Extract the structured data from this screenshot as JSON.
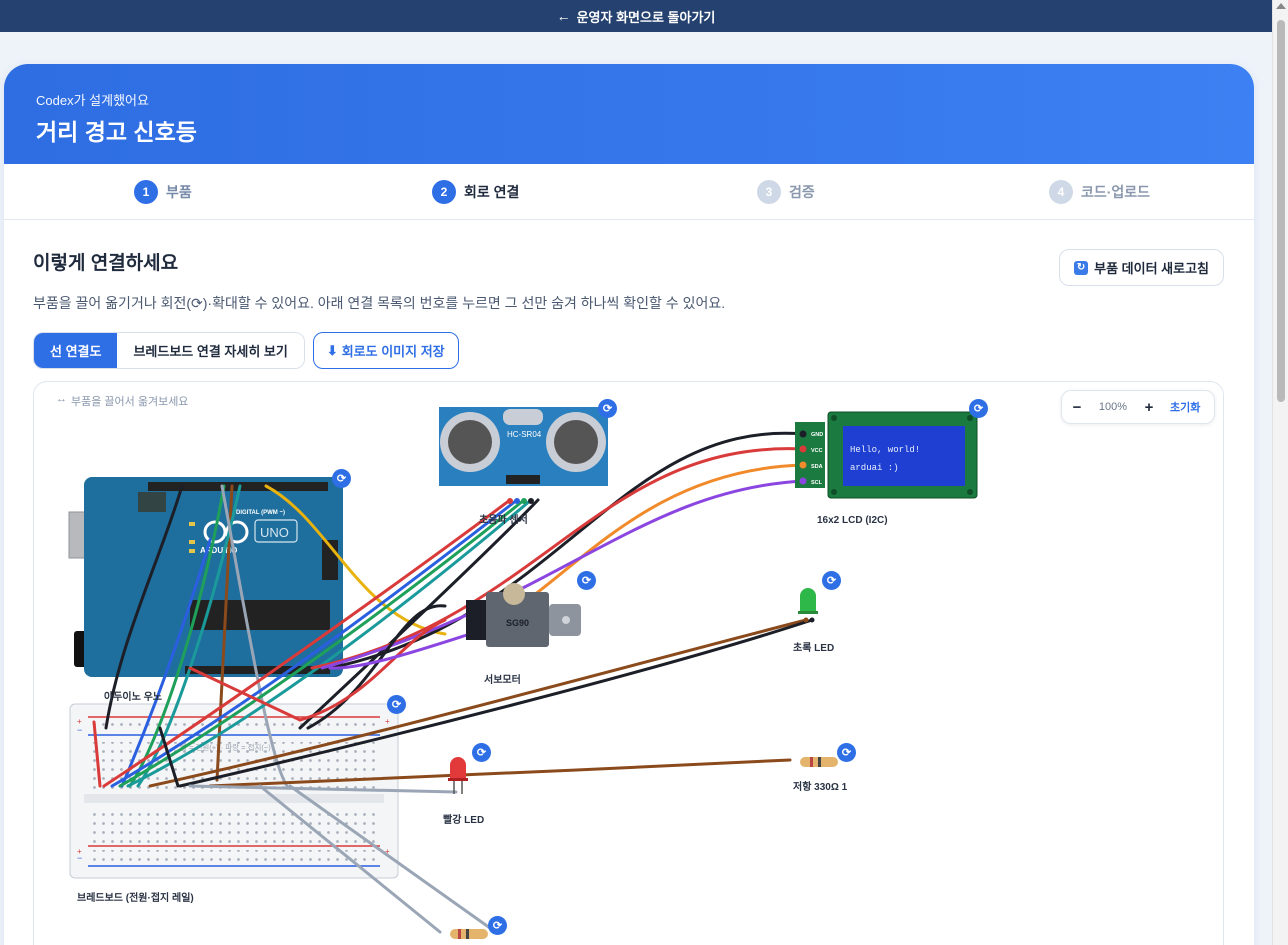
{
  "topbar": {
    "back_label": "운영자 화면으로 돌아가기"
  },
  "hero": {
    "subtitle": "Codex가 설계했어요",
    "title": "거리 경고 신호등"
  },
  "steps": [
    {
      "num": "1",
      "label": "부품"
    },
    {
      "num": "2",
      "label": "회로 연결"
    },
    {
      "num": "3",
      "label": "검증"
    },
    {
      "num": "4",
      "label": "코드·업로드"
    }
  ],
  "main": {
    "heading": "이렇게 연결하세요",
    "refresh_label": "부품 데이터 새로고침",
    "description": "부품을 끌어 옮기거나 회전(⟳)·확대할 수 있어요. 아래 연결 목록의 번호를 누르면 그 선만 숨겨 하나씩 확인할 수 있어요.",
    "tab_wire": "선 연결도",
    "tab_breadboard": "브레드보드 연결 자세히 보기",
    "save_image": "회로도 이미지 저장"
  },
  "canvas": {
    "hint": "부품을 끌어서 옮겨보세요",
    "zoom": {
      "minus": "−",
      "value": "100%",
      "plus": "+",
      "reset": "초기화"
    },
    "components": {
      "arduino": "아두이노 우노",
      "ultrasonic": "초음파 센서",
      "ultrasonic_chip": "HC-SR04",
      "lcd": "16x2 LCD (I2C)",
      "lcd_line1": "Hello, world!",
      "lcd_line2": "arduai :)",
      "lcd_pins": [
        "GND",
        "VCC",
        "SDA",
        "SCL"
      ],
      "servo": "서보모터",
      "servo_chip": "SG90",
      "green_led": "초록 LED",
      "red_led": "빨강 LED",
      "resistor": "저항 330Ω 1",
      "breadboard": "브레드보드 (전원·접지 레일)",
      "breadboard_note": "빨 = 전원(+) · 파랑 = 접지(−)",
      "uno_badge": "UNO",
      "uno_brand": "ARDUINO",
      "digital_label": "DIGITAL (PWM ~)"
    }
  },
  "colors": {
    "accent": "#2f6fe6",
    "topbar": "#24416f",
    "wire_red": "#d93a3a",
    "wire_black": "#1c1f27",
    "wire_orange": "#f08a2a",
    "wire_purple": "#8b45e0",
    "wire_blue": "#2a5fe0",
    "wire_green": "#1fa05a",
    "wire_teal": "#1a9a9a",
    "wire_yellow": "#e8b20f",
    "wire_brown": "#8a4a1c",
    "wire_gray": "#9aa6b6",
    "arduino_board": "#1e6e9e"
  }
}
